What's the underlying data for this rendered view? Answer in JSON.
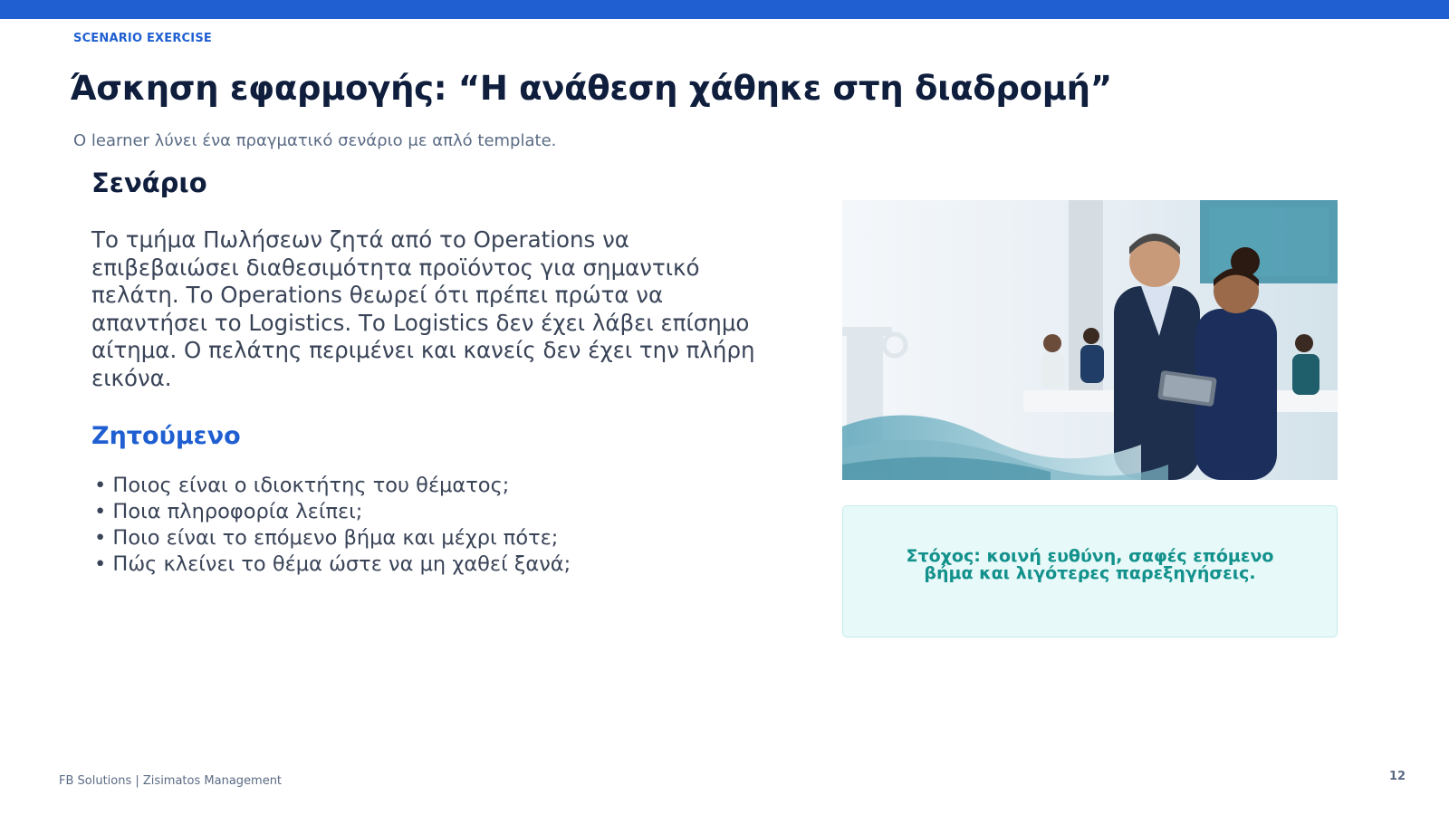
{
  "header": {
    "eyebrow": "SCENARIO EXERCISE",
    "title": "Άσκηση εφαρμογής: “Η ανάθεση χάθηκε στη διαδρομή”",
    "subtitle": "Ο learner λύνει ένα πραγματικό σενάριο με απλό template."
  },
  "scenario": {
    "heading": "Σενάριο",
    "text": "Το τμήμα Πωλήσεων ζητά από το Operations να επιβεβαιώσει διαθεσιμότητα προϊόντος για σημαντικό πελάτη. Το Operations θεωρεί ότι πρέπει πρώτα να απαντήσει το Logistics. Το Logistics δεν έχει λάβει επίσημο αίτημα. Ο πελάτης περιμένει και κανείς δεν έχει την πλήρη εικόνα."
  },
  "task": {
    "heading": "Ζητούμενο",
    "items": [
      "• Ποιος είναι ο ιδιοκτήτης του θέματος;",
      "• Ποια πληροφορία λείπει;",
      "• Ποιο είναι το επόμενο βήμα και μέχρι πότε;",
      "• Πώς κλείνει το θέμα ώστε να μη χαθεί ξανά;"
    ]
  },
  "photo": {
    "icon": "office-team-photo",
    "alt": ""
  },
  "goal": {
    "text": "Στόχος: κοινή ευθύνη, σαφές επόμενο βήμα και λιγότερες παρεξηγήσεις."
  },
  "footer": {
    "text": "FB Solutions | Zisimatos Management",
    "page_number": "12"
  },
  "colors": {
    "accent": "#1f5fd1",
    "title": "#0f1e3d",
    "body_text": "#3a4458",
    "muted": "#5b6b85",
    "goal_text": "#13918c",
    "goal_bg": "#e8f9f9"
  }
}
